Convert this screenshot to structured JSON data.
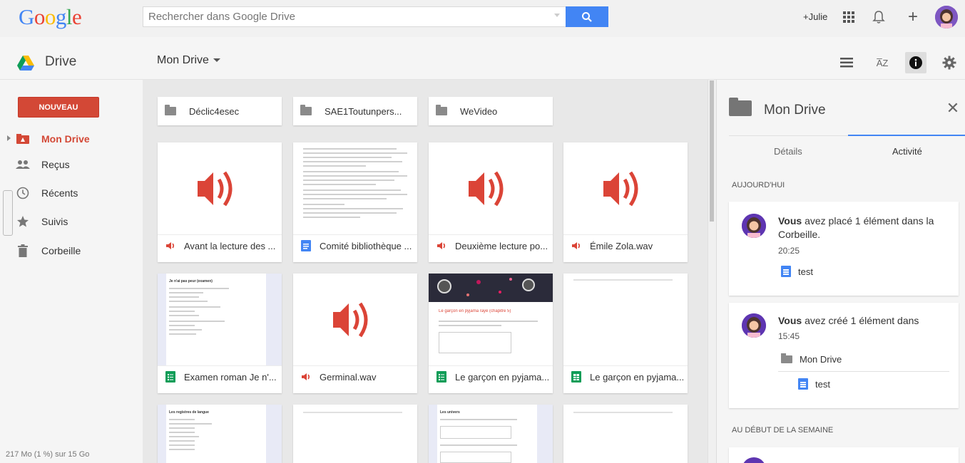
{
  "header": {
    "logo_text": "Google",
    "search_placeholder": "Rechercher dans Google Drive",
    "user_link": "+Julie"
  },
  "toolbar": {
    "app_name": "Drive",
    "location": "Mon Drive"
  },
  "sidebar": {
    "new_button": "NOUVEAU",
    "items": [
      {
        "label": "Mon Drive",
        "icon": "drive-folder-icon",
        "active": true
      },
      {
        "label": "Reçus",
        "icon": "people-icon",
        "active": false
      },
      {
        "label": "Récents",
        "icon": "clock-icon",
        "active": false
      },
      {
        "label": "Suivis",
        "icon": "star-icon",
        "active": false
      },
      {
        "label": "Corbeille",
        "icon": "trash-icon",
        "active": false
      }
    ],
    "storage": "217 Mo (1 %) sur 15 Go"
  },
  "folders": [
    {
      "name": "Déclic4esec"
    },
    {
      "name": "SAE1Toutunpers..."
    },
    {
      "name": "WeVideo"
    }
  ],
  "files": [
    {
      "name": "Avant la lecture des ...",
      "type": "audio"
    },
    {
      "name": "Comité bibliothèque ...",
      "type": "document"
    },
    {
      "name": "Deuxième lecture po...",
      "type": "audio"
    },
    {
      "name": "Émile Zola.wav",
      "type": "audio"
    },
    {
      "name": "Examen roman Je n'...",
      "type": "form"
    },
    {
      "name": "Germinal.wav",
      "type": "audio"
    },
    {
      "name": "Le garçon en pyjama...",
      "type": "form"
    },
    {
      "name": "Le garçon en pyjama...",
      "type": "spreadsheet"
    }
  ],
  "thumb_text": {
    "form1_title": "Je n'ai pas peur (examen)",
    "form2_title": "Le garçon en pyjama rayé (chapitre 5)",
    "form3_title": "Les registres de langue",
    "form4_title": "Les univers"
  },
  "panel": {
    "title": "Mon Drive",
    "tab_details": "Détails",
    "tab_activity": "Activité",
    "today_label": "AUJOURD'HUI",
    "week_label": "AU DÉBUT DE LA SEMAINE",
    "activities": [
      {
        "bold": "Vous",
        "text": " avez placé 1 élément dans la Corbeille.",
        "time": "20:25",
        "item": "test"
      },
      {
        "bold": "Vous",
        "text": " avez créé 1 élément dans",
        "time": "15:45",
        "folder": "Mon Drive",
        "item": "test"
      }
    ]
  },
  "colors": {
    "accent_red": "#d34836",
    "accent_blue": "#4285f4",
    "form_green": "#0f9d58",
    "audio_red": "#db4437"
  }
}
